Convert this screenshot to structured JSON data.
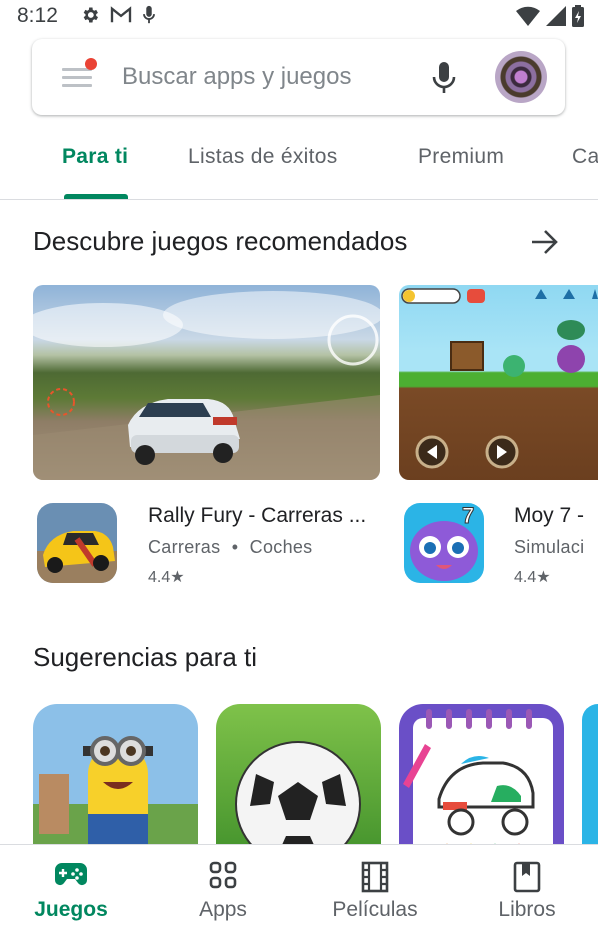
{
  "status_bar": {
    "time": "8:12"
  },
  "search": {
    "placeholder": "Buscar apps y juegos"
  },
  "tabs": [
    {
      "label": "Para ti"
    },
    {
      "label": "Listas de éxitos"
    },
    {
      "label": "Premium"
    },
    {
      "label": "Ca"
    }
  ],
  "sections": {
    "recommended": {
      "title": "Descubre juegos recomendados",
      "apps": [
        {
          "title": "Rally Fury - Carreras ...",
          "genre": "Carreras",
          "subgenre": "Coches",
          "rating": "4.4"
        },
        {
          "title": "Moy 7 -",
          "genre": "Simulaci",
          "rating": "4.4"
        }
      ]
    },
    "suggestions": {
      "title": "Sugerencias para ti"
    }
  },
  "bottom_nav": [
    {
      "label": "Juegos",
      "icon": "gamepad-icon"
    },
    {
      "label": "Apps",
      "icon": "apps-grid-icon"
    },
    {
      "label": "Películas",
      "icon": "film-icon"
    },
    {
      "label": "Libros",
      "icon": "book-icon"
    }
  ],
  "colors": {
    "accent": "#01875f",
    "text_secondary": "#5f6368",
    "notification_dot": "#ea4335"
  }
}
